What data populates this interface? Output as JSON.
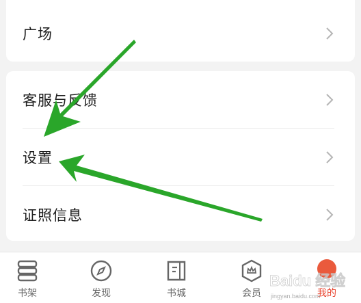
{
  "menu": {
    "plaza": "广场",
    "feedback": "客服与反馈",
    "settings": "设置",
    "license": "证照信息"
  },
  "tabbar": {
    "bookshelf": "书架",
    "discover": "发现",
    "bookstore": "书城",
    "member": "会员",
    "mine": "我的"
  },
  "colors": {
    "accent": "#e8412c",
    "arrow": "#2aa62a"
  },
  "watermark": {
    "text": "Baidu 经验",
    "url": "jingyan.baidu.com"
  }
}
